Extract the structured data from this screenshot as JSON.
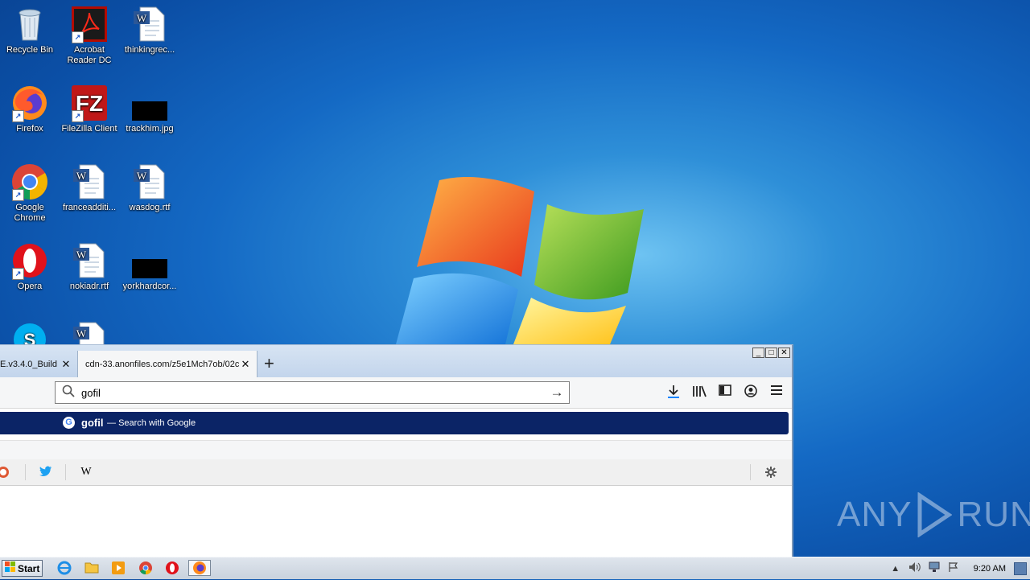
{
  "desktop": {
    "icons": [
      {
        "label": "Recycle Bin"
      },
      {
        "label": "Acrobat Reader DC"
      },
      {
        "label": "thinkingrec..."
      },
      {
        "label": "Firefox"
      },
      {
        "label": "FileZilla Client"
      },
      {
        "label": "trackhim.jpg"
      },
      {
        "label": "Google Chrome"
      },
      {
        "label": "franceadditi..."
      },
      {
        "label": "wasdog.rtf"
      },
      {
        "label": "Opera"
      },
      {
        "label": "nokiadr.rtf"
      },
      {
        "label": "yorkhardcor..."
      }
    ]
  },
  "browser": {
    "tabs": [
      {
        "title": "E.v3.4.0_Build"
      },
      {
        "title": "cdn-33.anonfiles.com/z5e1Mch7ob/02c"
      }
    ],
    "url_input": "gofil",
    "suggestion": {
      "term": "gofil",
      "separator": "—",
      "description": "Search with Google"
    },
    "window_buttons": {
      "minimize": "_",
      "maximize": "□",
      "close": "✕"
    }
  },
  "watermark": {
    "left": "ANY",
    "right": "RUN"
  },
  "taskbar": {
    "start_label": "Start",
    "clock": "9:20 AM"
  },
  "colors": {
    "suggestion_bg": "#0b2466",
    "desktop_bg": "#1469c4"
  }
}
